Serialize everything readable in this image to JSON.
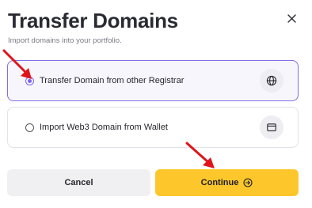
{
  "dialog": {
    "title": "Transfer Domains",
    "subtitle": "Import domains into your portfolio."
  },
  "options": [
    {
      "label": "Transfer Domain from other Registrar",
      "selected": true,
      "icon": "globe-icon"
    },
    {
      "label": "Import Web3 Domain from Wallet",
      "selected": false,
      "icon": "wallet-icon"
    }
  ],
  "buttons": {
    "cancel": "Cancel",
    "continue": "Continue"
  },
  "colors": {
    "accent": "#7c66f0",
    "continue_bg": "#fdc72c",
    "annotation_arrow": "#e0141b"
  }
}
